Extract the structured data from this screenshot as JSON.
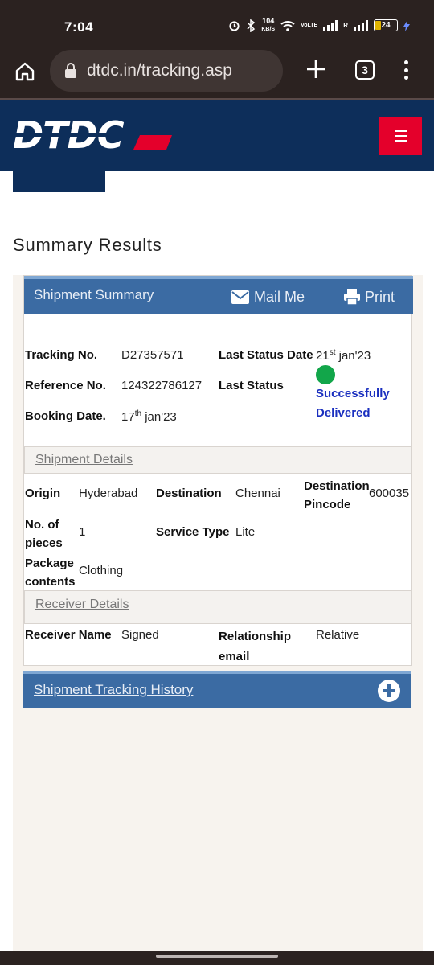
{
  "status_bar": {
    "time": "7:04",
    "net_speed_value": "104",
    "net_speed_unit": "KB/S",
    "volte": "VoLTE",
    "roaming": "R",
    "battery": "24"
  },
  "browser": {
    "url": "dtdc.in/tracking.asp",
    "tab_count": "3"
  },
  "site": {
    "logo_text": "DTDC",
    "brand_colors": {
      "navy": "#0d2e5a",
      "red": "#e4002b"
    }
  },
  "page": {
    "title": "Summary Results"
  },
  "summary": {
    "header": "Shipment Summary",
    "mail_label": "Mail Me",
    "print_label": "Print",
    "tracking_no_label": "Tracking No.",
    "tracking_no": "D27357571",
    "reference_no_label": "Reference No.",
    "reference_no": "124322786127",
    "booking_date_label": "Booking Date.",
    "booking_day": "17",
    "booking_suffix": "th",
    "booking_rest": " jan'23",
    "last_status_date_label": "Last Status Date",
    "last_status_day": "21",
    "last_status_suffix": "st",
    "last_status_rest": " jan'23",
    "last_status_label": "Last Status",
    "last_status_line1": "Successfully",
    "last_status_line2": "Delivered"
  },
  "shipment_details": {
    "header": "Shipment Details",
    "origin_label": "Origin",
    "origin": "Hyderabad",
    "destination_label": "Destination",
    "destination": "Chennai",
    "destination_pincode_label_1": "Destination",
    "destination_pincode_label_2": "Pincode",
    "destination_pincode": "600035",
    "pieces_label_1": "No. of",
    "pieces_label_2": "pieces",
    "pieces": "1",
    "service_type_label": "Service Type",
    "service_type": "Lite",
    "package_contents_label_1": "Package",
    "package_contents_label_2": "contents",
    "package_contents": "Clothing"
  },
  "receiver_details": {
    "header": "Receiver Details",
    "receiver_name_label": "Receiver Name",
    "receiver_name": "Signed",
    "relationship_label_1": "Relationship",
    "relationship_label_2": "email",
    "relationship": "Relative"
  },
  "history": {
    "header": "Shipment Tracking History"
  }
}
